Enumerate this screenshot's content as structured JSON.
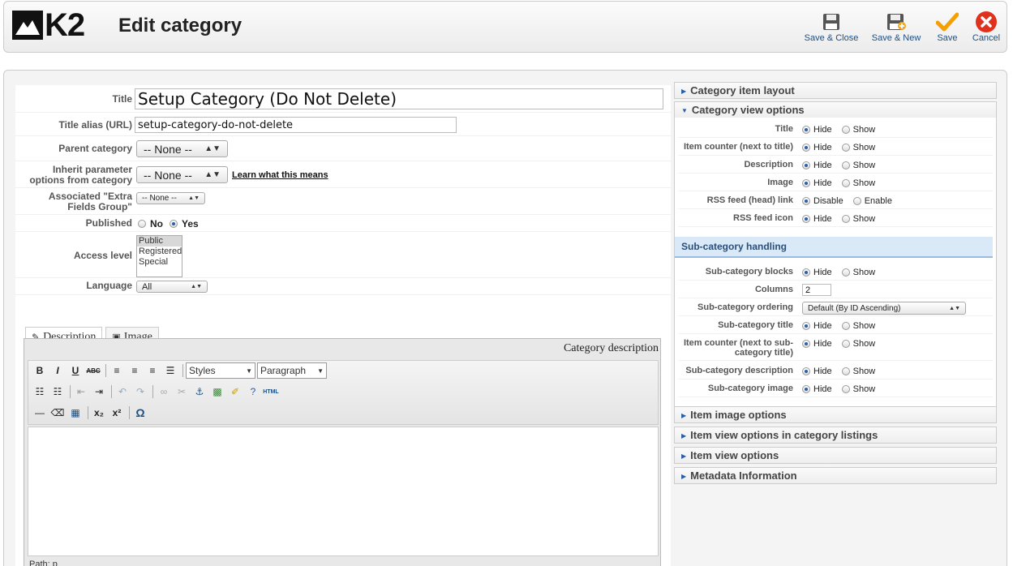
{
  "app": {
    "logo_text": "K2",
    "page_title": "Edit category"
  },
  "toolbar": {
    "save_close": "Save & Close",
    "save_new": "Save & New",
    "save": "Save",
    "cancel": "Cancel"
  },
  "form": {
    "title_label": "Title",
    "title_value": "Setup Category (Do Not Delete)",
    "alias_label": "Title alias (URL)",
    "alias_value": "setup-category-do-not-delete",
    "parent_label": "Parent category",
    "parent_value": "-- None --",
    "inherit_label_1": "Inherit parameter",
    "inherit_label_2": "options from category",
    "inherit_value": "-- None --",
    "inherit_link": "Learn what this means",
    "extra_label_1": "Associated \"Extra",
    "extra_label_2": "Fields Group\"",
    "extra_value": "-- None --",
    "published_label": "Published",
    "published_no": "No",
    "published_yes": "Yes",
    "access_label": "Access level",
    "access_options": [
      "Public",
      "Registered",
      "Special"
    ],
    "language_label": "Language",
    "language_value": "All"
  },
  "tabs": {
    "description": "Description",
    "image": "Image"
  },
  "editor": {
    "header": "Category description",
    "styles": "Styles",
    "paragraph": "Paragraph",
    "path": "Path: p"
  },
  "sidebar": {
    "item_layout": "Category item layout",
    "view_options": "Category view options",
    "rows": [
      {
        "label": "Title",
        "a": "Hide",
        "b": "Show"
      },
      {
        "label": "Item counter (next to title)",
        "a": "Hide",
        "b": "Show"
      },
      {
        "label": "Description",
        "a": "Hide",
        "b": "Show"
      },
      {
        "label": "Image",
        "a": "Hide",
        "b": "Show"
      },
      {
        "label": "RSS feed (head) link",
        "a": "Disable",
        "b": "Enable"
      },
      {
        "label": "RSS feed icon",
        "a": "Hide",
        "b": "Show"
      }
    ],
    "sub_heading": "Sub-category handling",
    "sub": {
      "blocks_label": "Sub-category blocks",
      "columns_label": "Columns",
      "columns_value": "2",
      "ordering_label": "Sub-category ordering",
      "ordering_value": "Default (By ID Ascending)",
      "title_label": "Sub-category title",
      "counter_label_1": "Item counter (next to sub-",
      "counter_label_2": "category title)",
      "desc_label": "Sub-category description",
      "image_label": "Sub-category image",
      "hide": "Hide",
      "show": "Show"
    },
    "image_options": "Item image options",
    "listing_options": "Item view options in category listings",
    "item_view_options": "Item view options",
    "metadata": "Metadata Information"
  }
}
